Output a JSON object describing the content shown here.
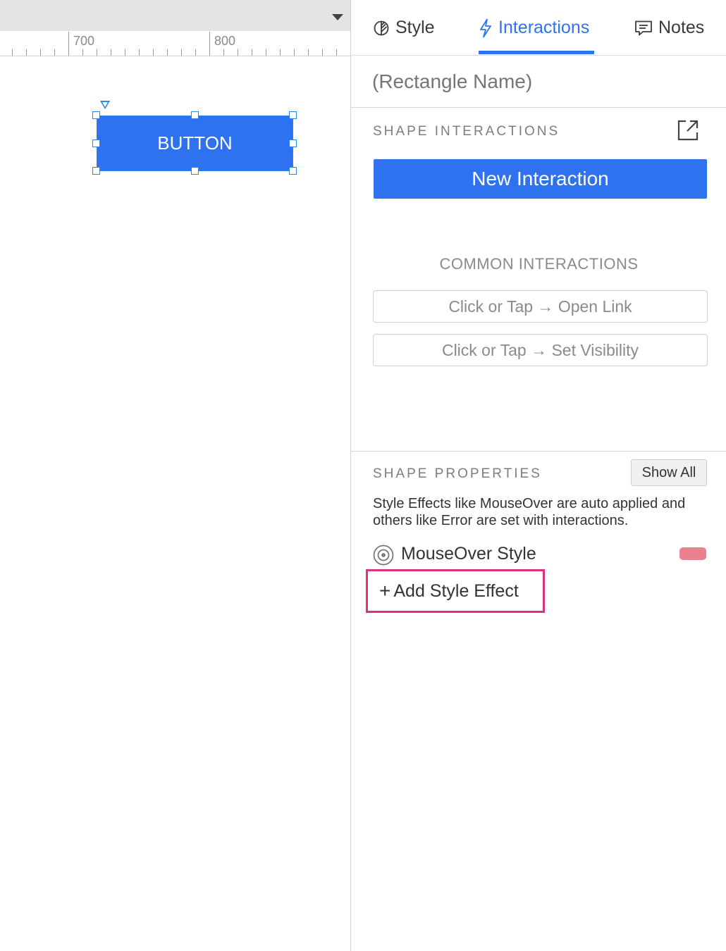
{
  "canvas": {
    "ruler_labels": [
      "700",
      "800"
    ],
    "widget_label": "BUTTON"
  },
  "tabs": [
    {
      "label": "Style",
      "icon": "style-leaf-icon"
    },
    {
      "label": "Interactions",
      "icon": "lightning-icon",
      "active": true
    },
    {
      "label": "Notes",
      "icon": "notes-comment-icon"
    }
  ],
  "panel": {
    "shape_name_placeholder": "(Rectangle Name)",
    "shape_interactions_title": "SHAPE INTERACTIONS",
    "new_interaction_label": "New Interaction",
    "common_interactions_title": "COMMON INTERACTIONS",
    "common_interactions": [
      "Click or Tap → Open Link",
      "Click or Tap → Set Visibility"
    ],
    "shape_properties_title": "SHAPE PROPERTIES",
    "show_all_label": "Show All",
    "properties_description": "Style Effects like MouseOver are auto applied and others like Error are set with interactions.",
    "mouseover_label": "MouseOver Style",
    "add_style_effect_label": "Add Style Effect",
    "add_style_effect_prefix": "+"
  },
  "colors": {
    "accent": "#2f72f0",
    "highlight_box": "#e0307f",
    "mouseover_swatch": "#e8828f"
  }
}
